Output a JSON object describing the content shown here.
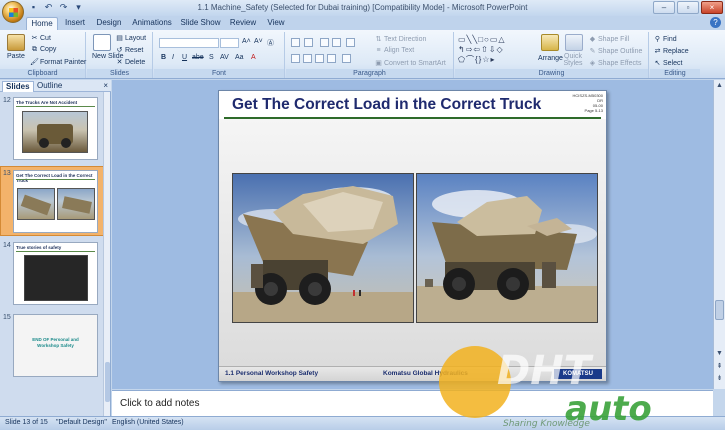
{
  "window": {
    "title": "1.1 Machine_Safety (Selected for Dubai training) [Compatibility Mode] - Microsoft PowerPoint"
  },
  "tabs": [
    {
      "label": "Home",
      "active": true
    },
    {
      "label": "Insert"
    },
    {
      "label": "Design"
    },
    {
      "label": "Animations"
    },
    {
      "label": "Slide Show"
    },
    {
      "label": "Review"
    },
    {
      "label": "View"
    }
  ],
  "ribbon": {
    "clipboard": {
      "label": "Clipboard",
      "paste": "Paste",
      "cut": "Cut",
      "copy": "Copy",
      "format_painter": "Format Painter"
    },
    "slides": {
      "label": "Slides",
      "new_slide": "New Slide",
      "layout": "Layout",
      "reset": "Reset",
      "delete": "Delete"
    },
    "font": {
      "label": "Font"
    },
    "paragraph": {
      "label": "Paragraph",
      "text_direction": "Text Direction",
      "align_text": "Align Text",
      "convert_smartart": "Convert to SmartArt"
    },
    "drawing": {
      "label": "Drawing",
      "arrange": "Arrange",
      "quick_styles": "Quick Styles",
      "shape_fill": "Shape Fill",
      "shape_outline": "Shape Outline",
      "shape_effects": "Shape Effects"
    },
    "editing": {
      "label": "Editing",
      "find": "Find",
      "replace": "Replace",
      "select": "Select"
    }
  },
  "left_pane": {
    "tabs": [
      {
        "label": "Slides",
        "active": true
      },
      {
        "label": "Outline"
      }
    ],
    "close": "×",
    "thumbnails": [
      {
        "number": "12",
        "title": "The Trucks Are Not Accident",
        "selected": false
      },
      {
        "number": "13",
        "title": "Get The Correct Load in the Correct Truck",
        "selected": true
      },
      {
        "number": "14",
        "title": "True stories of safety",
        "selected": false
      },
      {
        "number": "15",
        "title": "END OF Personal and Workshop Safety",
        "selected": false
      }
    ]
  },
  "slide": {
    "title": "Get The Correct Load in the Correct Truck",
    "meta_lines": [
      "HCISZS-M50300",
      "DR",
      "05-00",
      "Page 5-13"
    ],
    "footer_left": "1.1  Personal  Workshop  Safety",
    "footer_right": "Komatsu Global  Hydraulics",
    "logo": "KOMATSU"
  },
  "notes": {
    "placeholder": "Click to add notes"
  },
  "status": {
    "slide": "Slide 13 of 15",
    "theme": "\"Default Design\"",
    "language": "English (United States)"
  },
  "watermark": {
    "text_top": "DHT",
    "text_bottom": "auto",
    "sub": "Sharing Knowledge"
  },
  "colors": {
    "slide_title": "#1f2a6e",
    "title_rule": "#2e6b2a",
    "selection": "#f3b36b"
  }
}
